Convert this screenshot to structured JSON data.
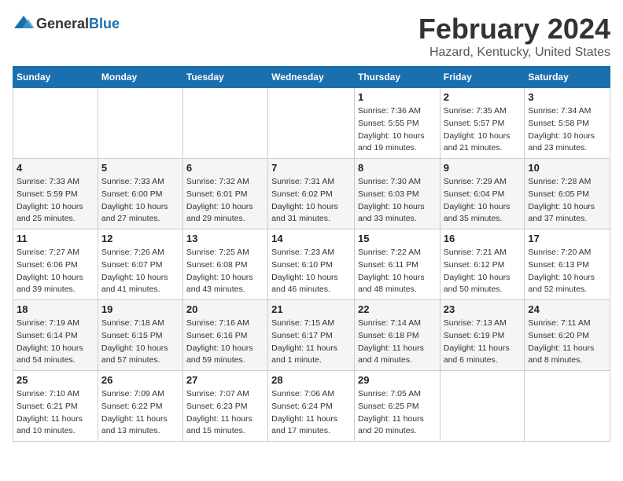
{
  "logo": {
    "general": "General",
    "blue": "Blue"
  },
  "title": "February 2024",
  "location": "Hazard, Kentucky, United States",
  "days_of_week": [
    "Sunday",
    "Monday",
    "Tuesday",
    "Wednesday",
    "Thursday",
    "Friday",
    "Saturday"
  ],
  "weeks": [
    [
      {
        "day": "",
        "info": ""
      },
      {
        "day": "",
        "info": ""
      },
      {
        "day": "",
        "info": ""
      },
      {
        "day": "",
        "info": ""
      },
      {
        "day": "1",
        "info": "Sunrise: 7:36 AM\nSunset: 5:55 PM\nDaylight: 10 hours\nand 19 minutes."
      },
      {
        "day": "2",
        "info": "Sunrise: 7:35 AM\nSunset: 5:57 PM\nDaylight: 10 hours\nand 21 minutes."
      },
      {
        "day": "3",
        "info": "Sunrise: 7:34 AM\nSunset: 5:58 PM\nDaylight: 10 hours\nand 23 minutes."
      }
    ],
    [
      {
        "day": "4",
        "info": "Sunrise: 7:33 AM\nSunset: 5:59 PM\nDaylight: 10 hours\nand 25 minutes."
      },
      {
        "day": "5",
        "info": "Sunrise: 7:33 AM\nSunset: 6:00 PM\nDaylight: 10 hours\nand 27 minutes."
      },
      {
        "day": "6",
        "info": "Sunrise: 7:32 AM\nSunset: 6:01 PM\nDaylight: 10 hours\nand 29 minutes."
      },
      {
        "day": "7",
        "info": "Sunrise: 7:31 AM\nSunset: 6:02 PM\nDaylight: 10 hours\nand 31 minutes."
      },
      {
        "day": "8",
        "info": "Sunrise: 7:30 AM\nSunset: 6:03 PM\nDaylight: 10 hours\nand 33 minutes."
      },
      {
        "day": "9",
        "info": "Sunrise: 7:29 AM\nSunset: 6:04 PM\nDaylight: 10 hours\nand 35 minutes."
      },
      {
        "day": "10",
        "info": "Sunrise: 7:28 AM\nSunset: 6:05 PM\nDaylight: 10 hours\nand 37 minutes."
      }
    ],
    [
      {
        "day": "11",
        "info": "Sunrise: 7:27 AM\nSunset: 6:06 PM\nDaylight: 10 hours\nand 39 minutes."
      },
      {
        "day": "12",
        "info": "Sunrise: 7:26 AM\nSunset: 6:07 PM\nDaylight: 10 hours\nand 41 minutes."
      },
      {
        "day": "13",
        "info": "Sunrise: 7:25 AM\nSunset: 6:08 PM\nDaylight: 10 hours\nand 43 minutes."
      },
      {
        "day": "14",
        "info": "Sunrise: 7:23 AM\nSunset: 6:10 PM\nDaylight: 10 hours\nand 46 minutes."
      },
      {
        "day": "15",
        "info": "Sunrise: 7:22 AM\nSunset: 6:11 PM\nDaylight: 10 hours\nand 48 minutes."
      },
      {
        "day": "16",
        "info": "Sunrise: 7:21 AM\nSunset: 6:12 PM\nDaylight: 10 hours\nand 50 minutes."
      },
      {
        "day": "17",
        "info": "Sunrise: 7:20 AM\nSunset: 6:13 PM\nDaylight: 10 hours\nand 52 minutes."
      }
    ],
    [
      {
        "day": "18",
        "info": "Sunrise: 7:19 AM\nSunset: 6:14 PM\nDaylight: 10 hours\nand 54 minutes."
      },
      {
        "day": "19",
        "info": "Sunrise: 7:18 AM\nSunset: 6:15 PM\nDaylight: 10 hours\nand 57 minutes."
      },
      {
        "day": "20",
        "info": "Sunrise: 7:16 AM\nSunset: 6:16 PM\nDaylight: 10 hours\nand 59 minutes."
      },
      {
        "day": "21",
        "info": "Sunrise: 7:15 AM\nSunset: 6:17 PM\nDaylight: 11 hours\nand 1 minute."
      },
      {
        "day": "22",
        "info": "Sunrise: 7:14 AM\nSunset: 6:18 PM\nDaylight: 11 hours\nand 4 minutes."
      },
      {
        "day": "23",
        "info": "Sunrise: 7:13 AM\nSunset: 6:19 PM\nDaylight: 11 hours\nand 6 minutes."
      },
      {
        "day": "24",
        "info": "Sunrise: 7:11 AM\nSunset: 6:20 PM\nDaylight: 11 hours\nand 8 minutes."
      }
    ],
    [
      {
        "day": "25",
        "info": "Sunrise: 7:10 AM\nSunset: 6:21 PM\nDaylight: 11 hours\nand 10 minutes."
      },
      {
        "day": "26",
        "info": "Sunrise: 7:09 AM\nSunset: 6:22 PM\nDaylight: 11 hours\nand 13 minutes."
      },
      {
        "day": "27",
        "info": "Sunrise: 7:07 AM\nSunset: 6:23 PM\nDaylight: 11 hours\nand 15 minutes."
      },
      {
        "day": "28",
        "info": "Sunrise: 7:06 AM\nSunset: 6:24 PM\nDaylight: 11 hours\nand 17 minutes."
      },
      {
        "day": "29",
        "info": "Sunrise: 7:05 AM\nSunset: 6:25 PM\nDaylight: 11 hours\nand 20 minutes."
      },
      {
        "day": "",
        "info": ""
      },
      {
        "day": "",
        "info": ""
      }
    ]
  ]
}
